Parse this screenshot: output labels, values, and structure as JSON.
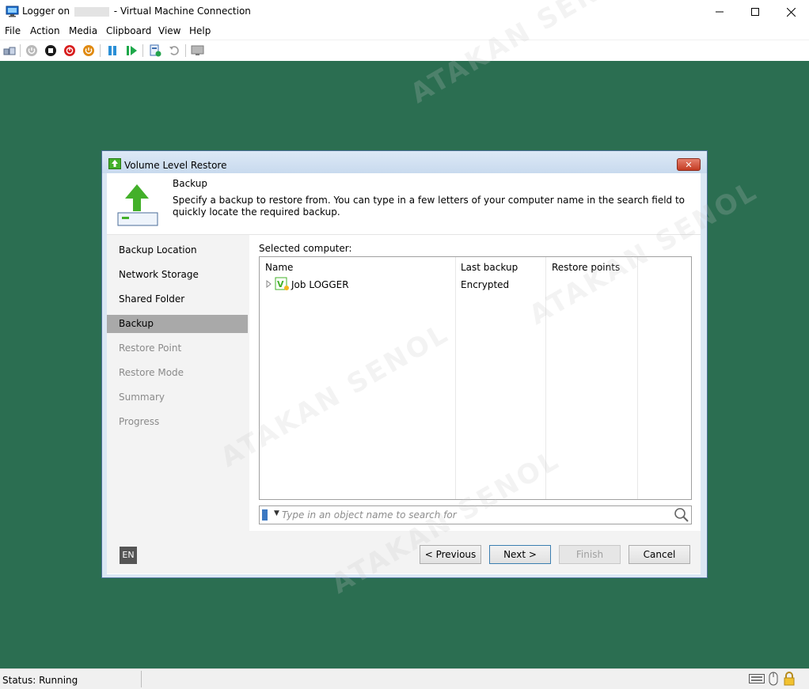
{
  "window": {
    "title_prefix": "Logger on",
    "title_suffix": "- Virtual Machine Connection",
    "minimize_symbol": "—",
    "maximize_symbol": "☐",
    "close_symbol": "✕"
  },
  "menu": [
    "File",
    "Action",
    "Media",
    "Clipboard",
    "View",
    "Help"
  ],
  "toolbar": [
    {
      "name": "ctrl-alt-del-icon"
    },
    {
      "name": "start-icon"
    },
    {
      "name": "turn-off-icon"
    },
    {
      "name": "shut-down-icon"
    },
    {
      "name": "save-icon"
    },
    {
      "name": "pause-icon"
    },
    {
      "name": "resume-icon"
    },
    {
      "name": "checkpoint-icon"
    },
    {
      "name": "revert-icon"
    },
    {
      "name": "enhanced-session-icon"
    }
  ],
  "dialog": {
    "title": "Volume Level Restore",
    "close_symbol": "✕",
    "header": {
      "title": "Backup",
      "description": "Specify a backup to restore from. You can type in a few letters of your computer name in the search field to quickly locate the required backup."
    },
    "steps": [
      {
        "label": "Backup Location",
        "state": "done"
      },
      {
        "label": "Network Storage",
        "state": "done"
      },
      {
        "label": "Shared Folder",
        "state": "done"
      },
      {
        "label": "Backup",
        "state": "active"
      },
      {
        "label": "Restore Point",
        "state": "disabled"
      },
      {
        "label": "Restore Mode",
        "state": "disabled"
      },
      {
        "label": "Summary",
        "state": "disabled"
      },
      {
        "label": "Progress",
        "state": "disabled"
      }
    ],
    "selected_label": "Selected computer:",
    "columns": [
      "Name",
      "Last backup",
      "Restore points"
    ],
    "rows": [
      {
        "name": "Job LOGGER",
        "last_backup": "Encrypted",
        "restore_points": ""
      }
    ],
    "search_placeholder": "Type in an object name to search for",
    "language": "EN",
    "buttons": {
      "previous": "< Previous",
      "next": "Next >",
      "finish": "Finish",
      "cancel": "Cancel"
    }
  },
  "watermark": "ATAKAN SENOL",
  "status": {
    "text": "Status: Running"
  },
  "colors": {
    "desktop": "#2b6e51",
    "dialog_frame": "#dbe7f4",
    "active_step": "#a9a9a9",
    "close_red": "#c43c23",
    "veeam_green": "#43b02a"
  }
}
